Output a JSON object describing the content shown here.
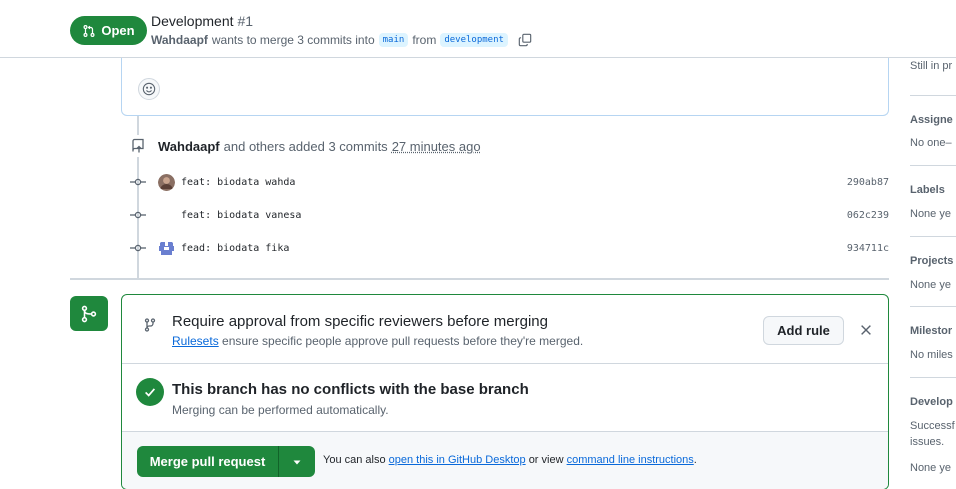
{
  "header": {
    "status_label": "Open",
    "title": "Development",
    "number": "#1",
    "author": "Wahdaapf",
    "merge_text_pre": "wants to merge 3 commits into",
    "base_branch": "main",
    "from_text": "from",
    "head_branch": "development"
  },
  "timeline": {
    "event_author": "Wahdaapf",
    "event_text": "and others added 3 commits",
    "event_time": "27 minutes ago",
    "commits": [
      {
        "message": "feat: biodata wahda",
        "sha": "290ab87",
        "avatar": "photo"
      },
      {
        "message": "feat: biodata vanesa",
        "sha": "062c239",
        "avatar": "none"
      },
      {
        "message": "fead: biodata fika",
        "sha": "934711c",
        "avatar": "identicon"
      }
    ]
  },
  "merge_box": {
    "rule_title": "Require approval from specific reviewers before merging",
    "rule_link": "Rulesets",
    "rule_desc": "ensure specific people approve pull requests before they're merged.",
    "add_rule_label": "Add rule",
    "conflict_title": "This branch has no conflicts with the base branch",
    "conflict_desc": "Merging can be performed automatically.",
    "merge_button": "Merge pull request",
    "also_text_1": "You can also",
    "also_link_1": "open this in GitHub Desktop",
    "also_text_2": "or view",
    "also_link_2": "command line instructions",
    "also_text_3": "."
  },
  "sidebar": {
    "still_in_progress": "Still in pr",
    "assignees_head": "Assigne",
    "assignees_value": "No one–",
    "labels_head": "Labels",
    "labels_value": "None ye",
    "projects_head": "Projects",
    "projects_value": "None ye",
    "milestone_head": "Milestor",
    "milestone_value": "No miles",
    "development_head": "Develop",
    "development_value_1": "Successf",
    "development_value_2": "issues.",
    "development_value_3": "None ye"
  },
  "colors": {
    "open_green": "#1f883d",
    "link_blue": "#0969da",
    "border_gray": "#d0d7de"
  }
}
